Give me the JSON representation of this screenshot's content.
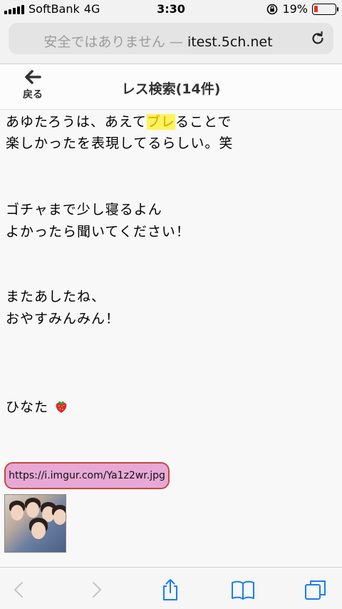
{
  "status": {
    "carrier": "SoftBank",
    "network": "4G",
    "time": "3:30",
    "battery_percent": "19%",
    "battery_level": 0.19,
    "battery_color": "#e3342f"
  },
  "address": {
    "insecure_label": "安全ではありません —",
    "domain": "itest.5ch.net",
    "reload_icon": "reload-icon"
  },
  "nav": {
    "back_label": "戻る",
    "title": "レス検索(14件)"
  },
  "post": {
    "line1_pre": "あゆたろうは、あえて",
    "line1_highlight": "ブレ",
    "line1_post": "ることで",
    "line2": "楽しかったを表現してるらしい。笑",
    "line3": "ゴチャまで少し寝るよん",
    "line4": "よかったら聞いてください！",
    "line5": "またあしたね、",
    "line6": "おやすみんみん！",
    "line7": "ひなた",
    "emoji_icon": "strawberry-icon",
    "image_link": "https://i.imgur.com/Ya1z2wr.jpg"
  },
  "toolbar": {
    "icons": [
      "back-arrow-icon",
      "forward-arrow-icon",
      "share-icon",
      "bookmarks-icon",
      "tabs-icon"
    ]
  },
  "colors": {
    "highlight_bg": "#fff35c",
    "link_bg": "#e7a8d6",
    "link_border": "#c9463e",
    "ios_blue": "#1a7cf5"
  }
}
